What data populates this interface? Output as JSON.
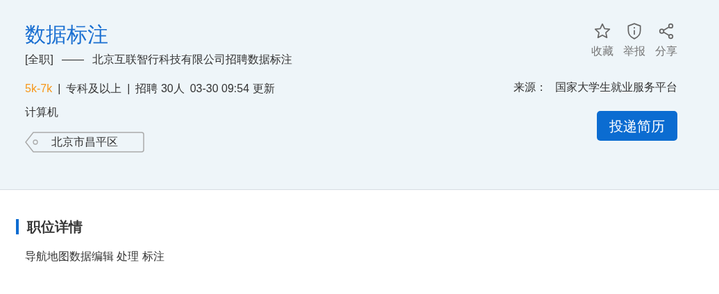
{
  "job": {
    "title": "数据标注",
    "type": "[全职]",
    "dash": "——",
    "company_line": "北京互联智行科技有限公司招聘数据标注",
    "salary": "5k-7k",
    "education": "专科及以上",
    "headcount": "招聘 30人",
    "updated": "03-30 09:54 更新",
    "separator": "|",
    "major": "计算机",
    "location": "北京市昌平区"
  },
  "actions": [
    {
      "kind": "star",
      "label": "收藏"
    },
    {
      "kind": "shield",
      "label": "举报"
    },
    {
      "kind": "share",
      "label": "分享"
    }
  ],
  "source": {
    "label": "来源：",
    "value": "国家大学生就业服务平台"
  },
  "apply_button": "投递简历",
  "details": {
    "heading": "职位详情",
    "text": "导航地图数据编辑 处理 标注"
  }
}
